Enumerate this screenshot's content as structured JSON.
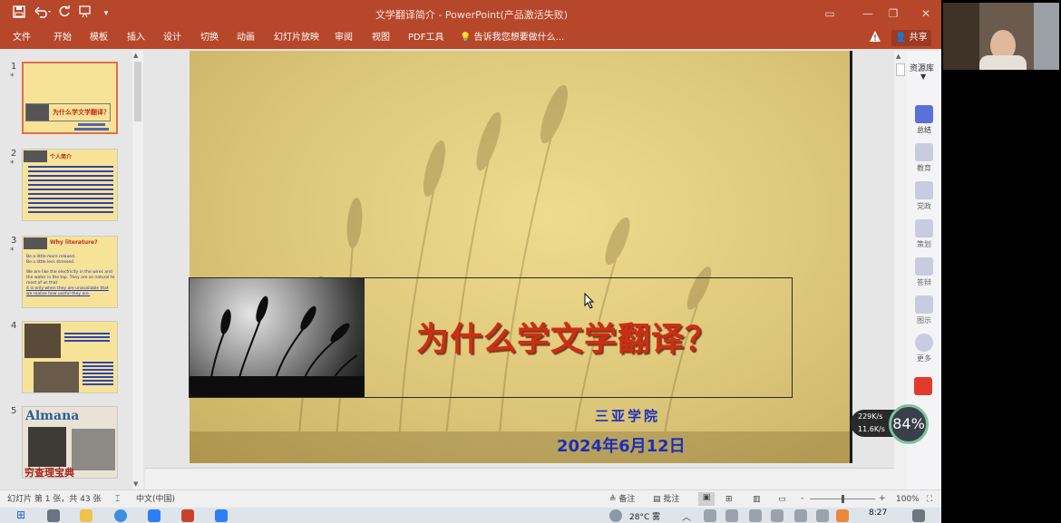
{
  "window": {
    "title": "文学翻译简介 - PowerPoint(产品激活失败)"
  },
  "quick_access": {
    "save_icon": "save-icon",
    "undo_icon": "undo-icon",
    "redo_icon": "redo-icon",
    "start_icon": "present-icon",
    "more_icon": "customize-icon"
  },
  "ribbon": {
    "tabs": [
      "文件",
      "开始",
      "模板",
      "插入",
      "设计",
      "切换",
      "动画",
      "幻灯片放映",
      "审阅",
      "视图",
      "PDF工具"
    ],
    "tell_me": "告诉我您想要做什么...",
    "share_label": "共享",
    "accent_color": "#b7472a"
  },
  "thumbnails": {
    "numbers": [
      "1",
      "2",
      "3",
      "4",
      "5"
    ],
    "star": "*",
    "slide1_title": "为什么学文学翻译？",
    "slide2_heading": "个人简介",
    "slide3_heading": "Why literature?",
    "slide3_lines": [
      "Be a little more relaxed.",
      "Be a little less stressed.",
      "We are like the electricity in the wires and the water in the tap. They are so natural to most of us that",
      "it is only when they are unavailable that we realise how useful they are."
    ],
    "slide5_title": "Almana",
    "slide5_caption": "穷查理宝典"
  },
  "slide": {
    "title": "为什么学文学翻译？",
    "school": "三亚学院",
    "date": "2024年6月12日",
    "background_color": "#e6d27f",
    "title_color": "#cf2d13",
    "text_color": "#1b2fb8"
  },
  "sidebar": {
    "header": "资源库",
    "items": [
      "总结",
      "教育",
      "党政",
      "策划",
      "答辩",
      "图示",
      "更多"
    ]
  },
  "network_widget": {
    "up": "229K/s",
    "down": "11.6K/s",
    "percent": "84%"
  },
  "statusbar": {
    "slide_info": "幻灯片 第 1 张，共 43 张",
    "language": "中文(中国)",
    "notes_label": "备注",
    "comments_label": "批注",
    "zoom_minus": "-",
    "zoom_plus": "+",
    "zoom": "100%",
    "zoom_level": 0.5
  },
  "taskbar": {
    "weather": "28°C 雾",
    "clock": "8:27"
  }
}
